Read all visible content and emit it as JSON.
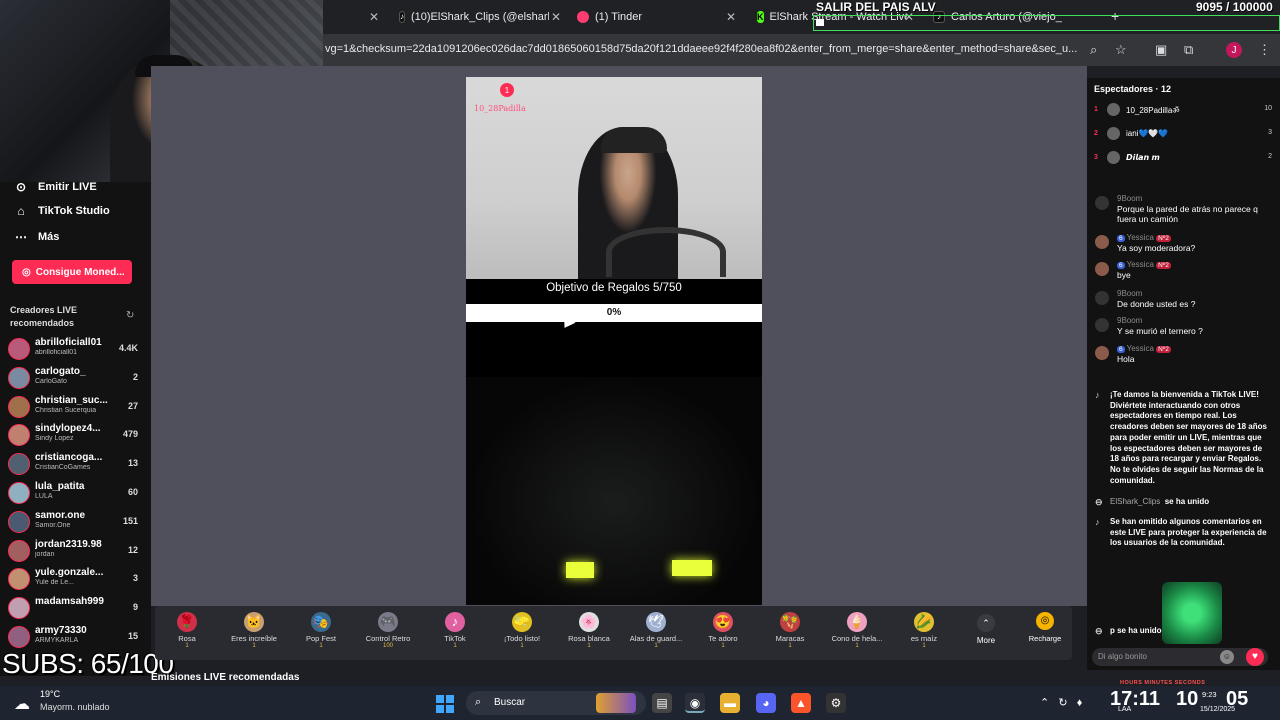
{
  "browser": {
    "tabs": [
      {
        "label": "(10)ElShark_Clips (@elshark",
        "icon": "tiktok-icon"
      },
      {
        "label": "(1) Tinder",
        "icon": "tinder-icon"
      },
      {
        "label": "ElShark Stream - Watch Live",
        "icon": "kick-icon"
      },
      {
        "label": "Carlos Arturo (@viejo_",
        "icon": "tiktok-icon"
      }
    ],
    "url": "vg=1&checksum=22da1091206ec026dac7dd01865060158d75da20f121ddaeee92f4f280ea8f02&enter_from_merge=share&enter_method=share&sec_u...",
    "profile_letter": "J"
  },
  "overlay": {
    "salir_text": "SALIR DEL PAIS ALV",
    "goal_count": "9095 / 100000",
    "goal_fraction": 0.09,
    "subs_text": "SUBS: 65/100",
    "time_labels": "HOURS   MINUTES   SECONDS"
  },
  "sidebar": {
    "menu": [
      {
        "label": "Emitir LIVE",
        "icon": "broadcast-icon"
      },
      {
        "label": "TikTok Studio",
        "icon": "home-icon"
      },
      {
        "label": "Más",
        "icon": "more-icon"
      }
    ],
    "coins_button": "Consigue Moned...",
    "recommended_title": "Creadores LIVE recomendados",
    "creators": [
      {
        "name": "abrilloficiall01",
        "sub": "abrilloficiall01",
        "count": "4.4K",
        "color": "#b85a7a"
      },
      {
        "name": "carlogato_",
        "sub": "CarloGato",
        "count": "2",
        "color": "#7a8aa0"
      },
      {
        "name": "christian_suc...",
        "sub": "Christian Sucerquia",
        "count": "27",
        "color": "#a0704a"
      },
      {
        "name": "sindylopez4...",
        "sub": "Sindy Lopez",
        "count": "479",
        "color": "#c08070"
      },
      {
        "name": "cristiancoga...",
        "sub": "CristianCoGames",
        "count": "13",
        "color": "#506070"
      },
      {
        "name": "lula_patita",
        "sub": "LULA",
        "count": "60",
        "color": "#8fb0c0"
      },
      {
        "name": "samor.one",
        "sub": "Samor.One",
        "count": "151",
        "color": "#4a5a70"
      },
      {
        "name": "jordan2319.98",
        "sub": "jordan",
        "count": "12",
        "color": "#a06060"
      },
      {
        "name": "yule.gonzale...",
        "sub": "Yule de Le...",
        "count": "3",
        "color": "#c09070"
      },
      {
        "name": "madamsah999",
        "sub": "",
        "count": "9",
        "color": "#c0a0b0"
      },
      {
        "name": "army73330",
        "sub": "ARMYKARLA",
        "count": "15",
        "color": "#906080"
      }
    ],
    "emisiones_label": "Emisiones LIVE recomendadas"
  },
  "stream": {
    "streamer_tag": "10_28Padilla",
    "badge": "1",
    "goal_label": "Objetivo de Regalos  5/750",
    "goal_pct_text": "0%",
    "goal_fraction": 0
  },
  "gifts": [
    {
      "label": "Rosa",
      "price": "1",
      "icon": "rose-icon",
      "glyph": "🌹",
      "color": "#d0304a"
    },
    {
      "label": "Eres increíble",
      "price": "1",
      "icon": "cat-icon",
      "glyph": "🐱",
      "color": "#c8a070"
    },
    {
      "label": "Pop Fest",
      "price": "1",
      "icon": "popfest-icon",
      "glyph": "🎭",
      "color": "#3a6a90"
    },
    {
      "label": "Control Retro",
      "price": "100",
      "icon": "gamepad-icon",
      "glyph": "🎮",
      "color": "#7a7a8a"
    },
    {
      "label": "TikTok",
      "price": "1",
      "icon": "tiktok-gift-icon",
      "glyph": "♪",
      "color": "#e060a0"
    },
    {
      "label": "¡Todo listo!",
      "price": "1",
      "icon": "sponge-icon",
      "glyph": "🧽",
      "color": "#e0c020"
    },
    {
      "label": "Rosa blanca",
      "price": "1",
      "icon": "white-rose-icon",
      "glyph": "🌸",
      "color": "#e0e0e0"
    },
    {
      "label": "Alas de guard...",
      "price": "1",
      "icon": "wings-icon",
      "glyph": "🕊",
      "color": "#a0b0d0"
    },
    {
      "label": "Te adoro",
      "price": "1",
      "icon": "heart-face-icon",
      "glyph": "😍",
      "color": "#e05060"
    },
    {
      "label": "Maracas",
      "price": "1",
      "icon": "maracas-icon",
      "glyph": "🪇",
      "color": "#c04040"
    },
    {
      "label": "Cono de hela...",
      "price": "1",
      "icon": "icecream-icon",
      "glyph": "🍦",
      "color": "#f0a0c0"
    },
    {
      "label": "es maíz",
      "price": "1",
      "icon": "corn-icon",
      "glyph": "🌽",
      "color": "#e0c030"
    }
  ],
  "gift_more": "More",
  "recharge": "Recharge",
  "chat": {
    "viewers_title": "Espectadores · 12",
    "viewers": [
      {
        "rank": "1",
        "name": "10_28Padillaॐ",
        "score": "10"
      },
      {
        "rank": "2",
        "name": "iani💙🤍💙",
        "score": "3"
      },
      {
        "rank": "3",
        "name": "𝘿𝙞𝙡𝙖𝙣 𝙢",
        "score": "2"
      }
    ],
    "messages": [
      {
        "user": "9Boom",
        "text": "Porque la pared de atrás no parece q fuera un camión"
      },
      {
        "user": "Yessica",
        "text": "Ya soy moderadora?"
      },
      {
        "user": "Yessica",
        "text": "bye"
      },
      {
        "user": "9Boom",
        "text": "De donde usted es ?"
      },
      {
        "user": "9Boom",
        "text": "Y se murió el ternero ?"
      },
      {
        "user": "Yessica",
        "text": "Hola"
      }
    ],
    "level_badge": "6",
    "rank_badge": "Nº2",
    "welcome": "¡Te damos la bienvenida a TikTok LIVE! Diviértete interactuando con otros espectadores en tiempo real. Los creadores deben ser mayores de 18 años para poder emitir un LIVE, mientras que los espectadores deben ser mayores de 18 años para recargar y enviar Regalos. No te olvides de seguir las Normas de la comunidad.",
    "join_user": "ElShark_Clips",
    "join_text": "se ha unido",
    "omitted": "Se han omitido algunos comentarios en este LIVE para proteger la experiencia de los usuarios de la comunidad.",
    "last_join": "p  se ha unido",
    "comment_placeholder": "Di algo bonito"
  },
  "taskbar": {
    "temp": "19°C",
    "weather": "Mayorm. nublado",
    "search": "Buscar",
    "clock_a": "17:11",
    "clock_b": "10",
    "clock_small": "9:23",
    "clock_sec": "05",
    "date": "15/12/2025",
    "lang": "LAA"
  }
}
